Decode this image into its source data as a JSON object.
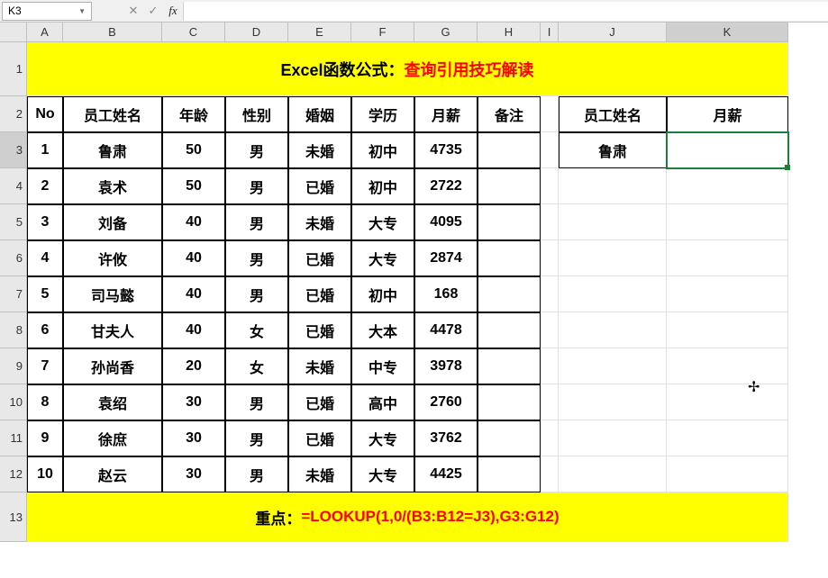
{
  "name_box": "K3",
  "formula": "",
  "col_headers": [
    "A",
    "B",
    "C",
    "D",
    "E",
    "F",
    "G",
    "H",
    "I",
    "J",
    "K"
  ],
  "row_headers": [
    "1",
    "2",
    "3",
    "4",
    "5",
    "6",
    "7",
    "8",
    "9",
    "10",
    "11",
    "12",
    "13"
  ],
  "title": {
    "t1": "Excel函数公式：",
    "t2": "查询引用技巧解读"
  },
  "headers": {
    "no": "No",
    "name": "员工姓名",
    "age": "年龄",
    "gender": "性别",
    "marital": "婚姻",
    "edu": "学历",
    "salary": "月薪",
    "remark": "备注"
  },
  "lookup": {
    "name_h": "员工姓名",
    "salary_h": "月薪",
    "name_v": "鲁肃",
    "salary_v": ""
  },
  "rows": [
    {
      "no": "1",
      "name": "鲁肃",
      "age": "50",
      "gender": "男",
      "marital": "未婚",
      "edu": "初中",
      "salary": "4735",
      "remark": ""
    },
    {
      "no": "2",
      "name": "袁术",
      "age": "50",
      "gender": "男",
      "marital": "已婚",
      "edu": "初中",
      "salary": "2722",
      "remark": ""
    },
    {
      "no": "3",
      "name": "刘备",
      "age": "40",
      "gender": "男",
      "marital": "未婚",
      "edu": "大专",
      "salary": "4095",
      "remark": ""
    },
    {
      "no": "4",
      "name": "许攸",
      "age": "40",
      "gender": "男",
      "marital": "已婚",
      "edu": "大专",
      "salary": "2874",
      "remark": ""
    },
    {
      "no": "5",
      "name": "司马懿",
      "age": "40",
      "gender": "男",
      "marital": "已婚",
      "edu": "初中",
      "salary": "168",
      "remark": ""
    },
    {
      "no": "6",
      "name": "甘夫人",
      "age": "40",
      "gender": "女",
      "marital": "已婚",
      "edu": "大本",
      "salary": "4478",
      "remark": ""
    },
    {
      "no": "7",
      "name": "孙尚香",
      "age": "20",
      "gender": "女",
      "marital": "未婚",
      "edu": "中专",
      "salary": "3978",
      "remark": ""
    },
    {
      "no": "8",
      "name": "袁绍",
      "age": "30",
      "gender": "男",
      "marital": "已婚",
      "edu": "高中",
      "salary": "2760",
      "remark": ""
    },
    {
      "no": "9",
      "name": "徐庶",
      "age": "30",
      "gender": "男",
      "marital": "已婚",
      "edu": "大专",
      "salary": "3762",
      "remark": ""
    },
    {
      "no": "10",
      "name": "赵云",
      "age": "30",
      "gender": "男",
      "marital": "未婚",
      "edu": "大专",
      "salary": "4425",
      "remark": ""
    }
  ],
  "footer": {
    "t1": "重点：",
    "t2": "=LOOKUP(1,0/(B3:B12=J3),G3:G12)"
  },
  "selected_col": "K",
  "selected_row": "3"
}
